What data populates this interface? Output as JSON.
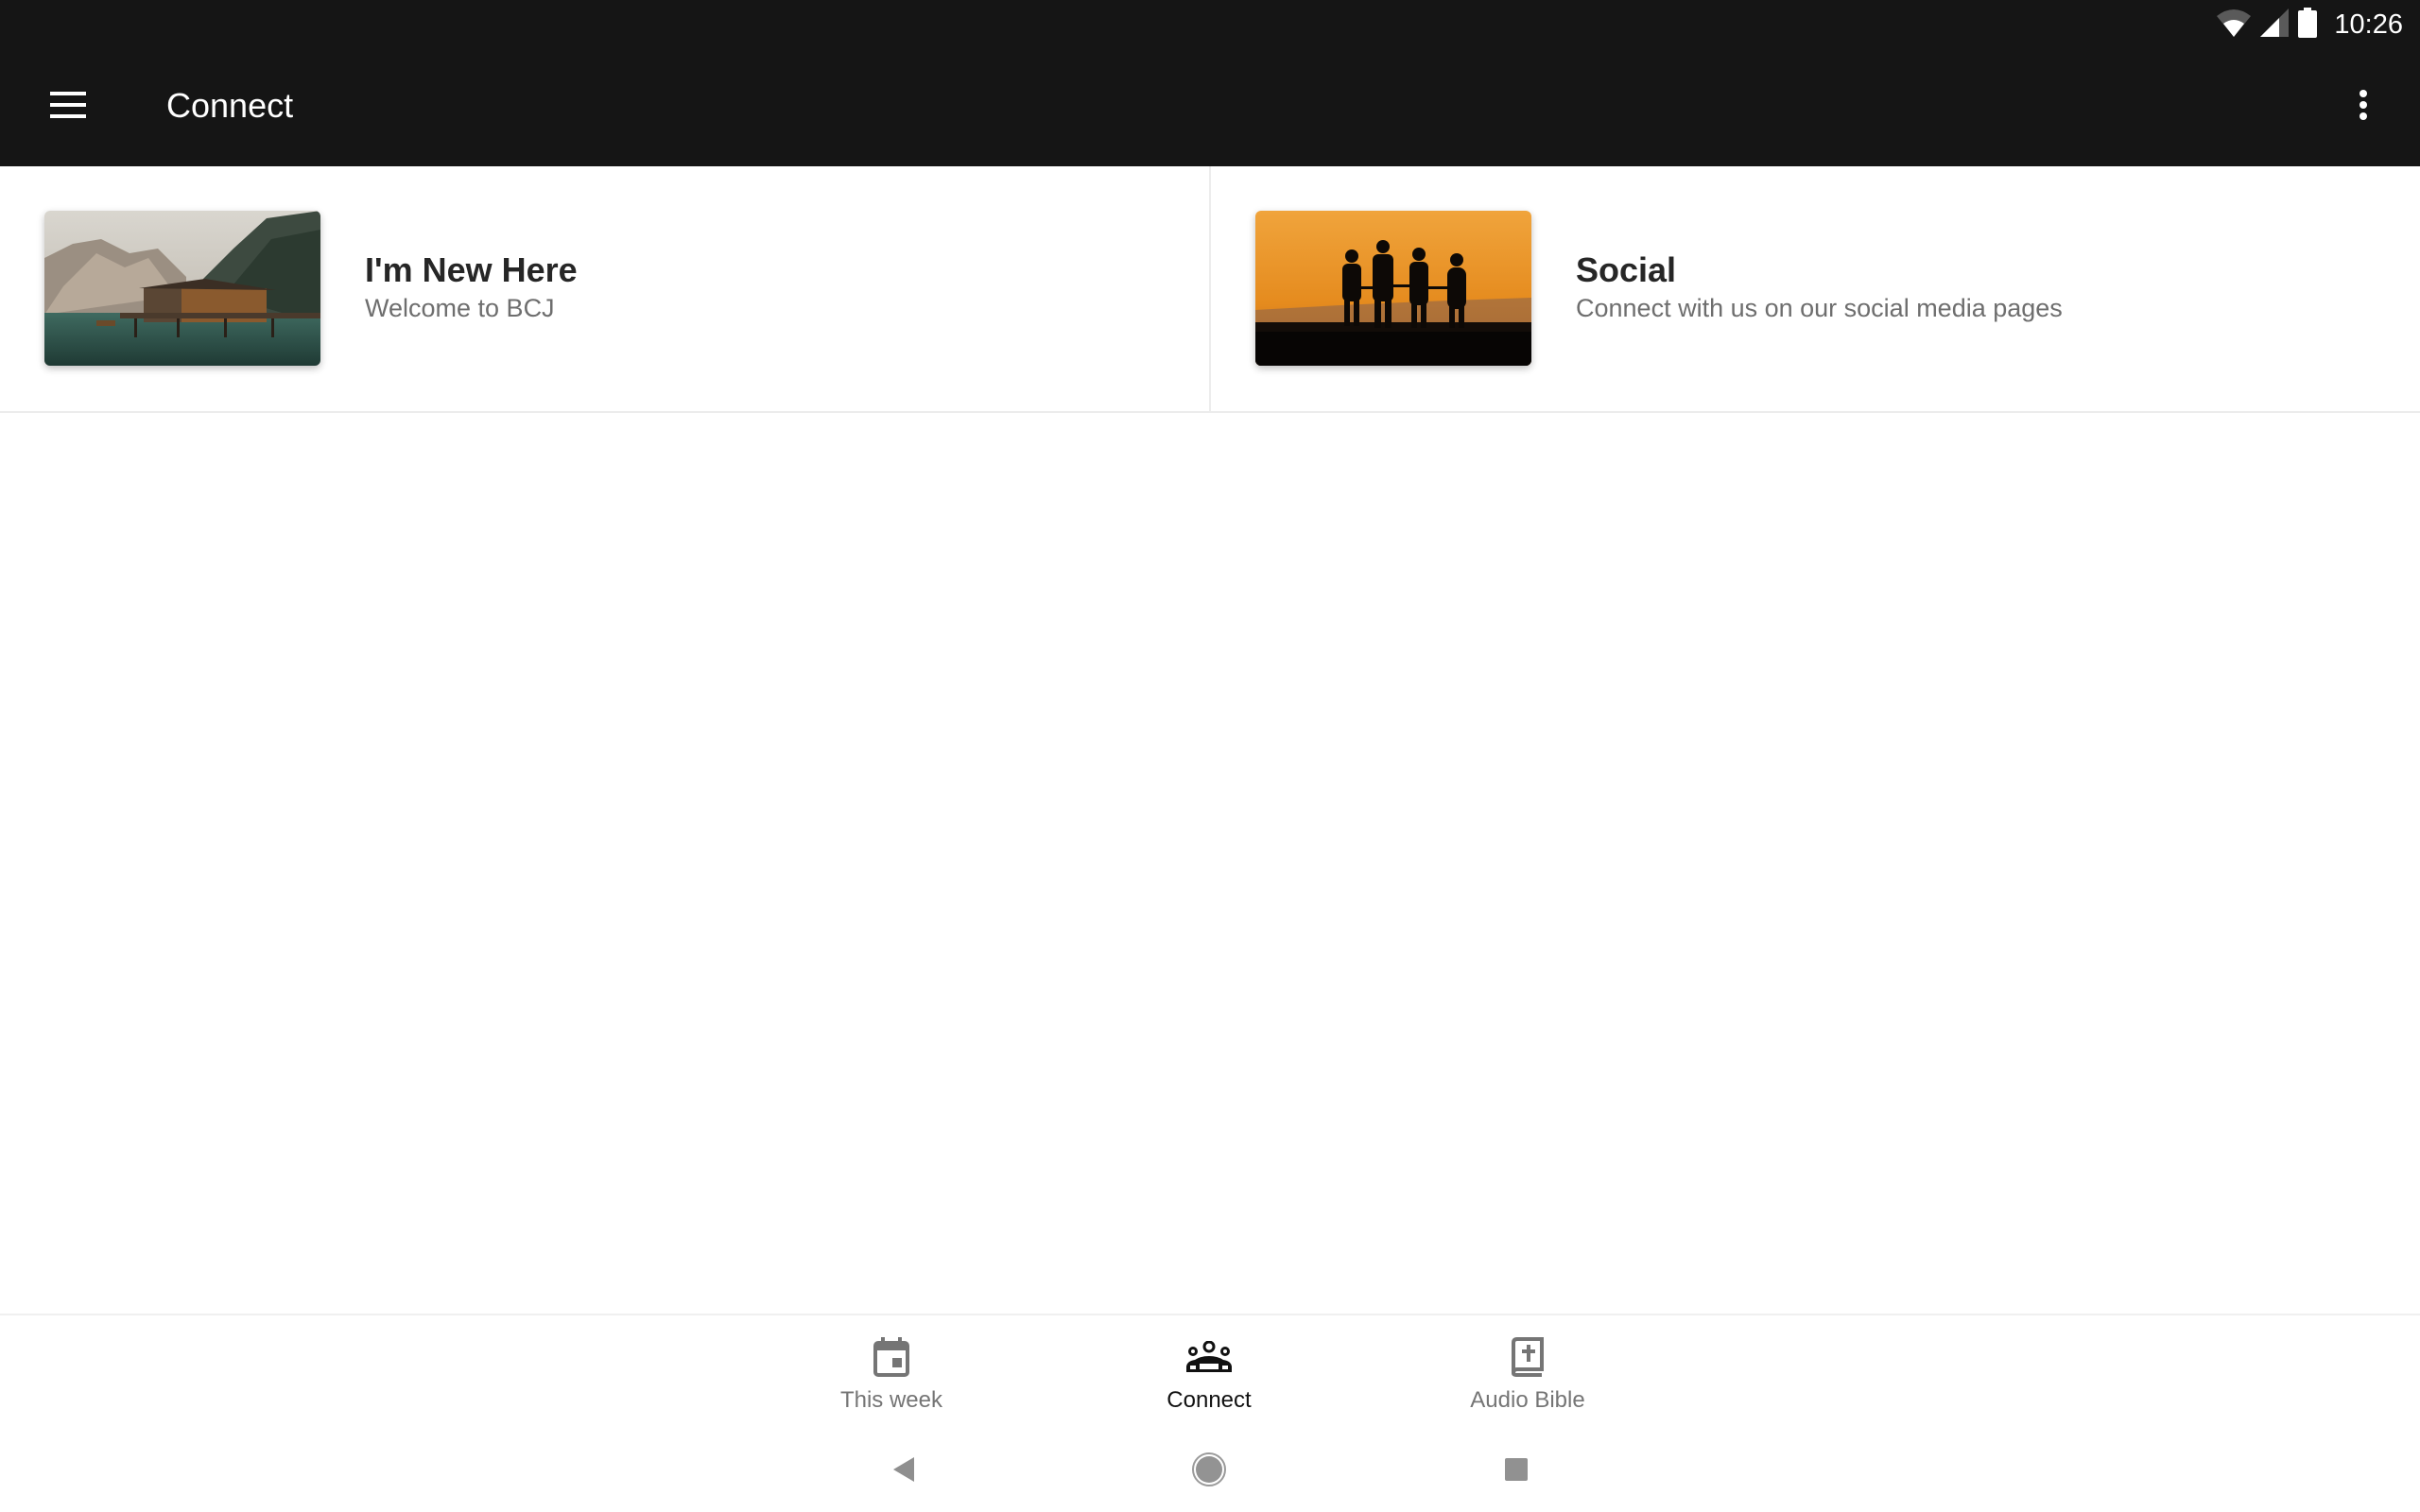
{
  "status_bar": {
    "time": "10:26",
    "icons": [
      "wifi-icon",
      "cellular-signal-icon",
      "battery-icon"
    ]
  },
  "app_bar": {
    "title": "Connect",
    "menu_icon": "hamburger-menu-icon",
    "overflow_icon": "more-vert-icon"
  },
  "cards": [
    {
      "title": "I'm New Here",
      "subtitle": "Welcome to BCJ",
      "image": "lake-cabin-mountains-photo"
    },
    {
      "title": "Social",
      "subtitle": "Connect with us on our social media pages",
      "image": "family-silhouette-sunset-photo"
    }
  ],
  "bottom_nav": {
    "items": [
      {
        "label": "This week",
        "icon": "calendar-icon",
        "active": false
      },
      {
        "label": "Connect",
        "icon": "groups-icon",
        "active": true
      },
      {
        "label": "Audio Bible",
        "icon": "bible-book-icon",
        "active": false
      }
    ]
  },
  "system_nav": {
    "buttons": [
      "back",
      "home",
      "recents"
    ]
  },
  "colors": {
    "app_bar": "#151515",
    "active_nav": "#111111",
    "inactive_nav": "#757575"
  }
}
